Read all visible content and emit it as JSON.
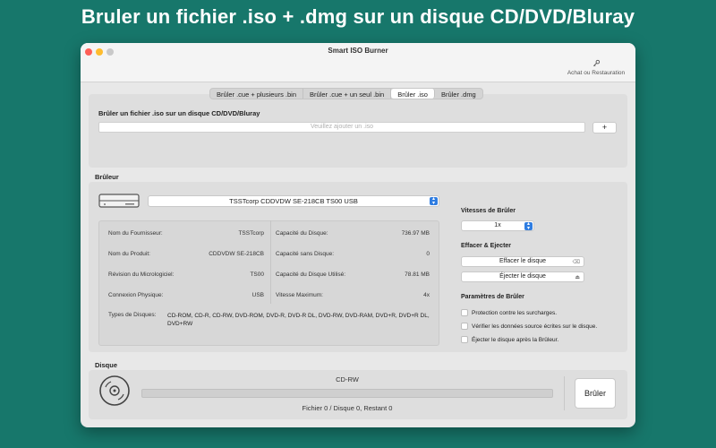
{
  "banner": {
    "title": "Bruler un fichier .iso + .dmg sur un disque CD/DVD/Bluray"
  },
  "window": {
    "title": "Smart ISO Burner",
    "toolbar_action_label": "Achat ou Restauration"
  },
  "tabs": [
    {
      "label": "Brûler .cue + plusieurs .bin",
      "active": false
    },
    {
      "label": "Brûler .cue + un seul .bin",
      "active": false
    },
    {
      "label": "Brûler .iso",
      "active": true
    },
    {
      "label": "Brûler .dmg",
      "active": false
    }
  ],
  "iso_section": {
    "title": "Brûler un fichier .iso sur un disque CD/DVD/Bluray",
    "placeholder": "Veuillez ajouter un .iso",
    "add_button": "+"
  },
  "burner": {
    "title": "Brûleur",
    "drive_selected": "TSSTcorp CDDVDW SE-218CB TS00 USB",
    "left_info": [
      {
        "label": "Nom du Fournisseur:",
        "value": "TSSTcorp"
      },
      {
        "label": "Nom du Produit:",
        "value": "CDDVDW SE-218CB"
      },
      {
        "label": "Révision du Micrologiciel:",
        "value": "TS00"
      },
      {
        "label": "Connexion Physique:",
        "value": "USB"
      }
    ],
    "right_info": [
      {
        "label": "Capacité du Disque:",
        "value": "736.97 MB"
      },
      {
        "label": "Capacité sans Disque:",
        "value": "0"
      },
      {
        "label": "Capacité du Disque Utilisé:",
        "value": "78.81 MB"
      },
      {
        "label": "Vitesse Maximum:",
        "value": "4x"
      }
    ],
    "disc_types_label": "Types de Disques:",
    "disc_types_value": "CD-ROM, CD-R, CD-RW, DVD-ROM, DVD-R, DVD-R DL, DVD-RW, DVD-RAM, DVD+R, DVD+R DL, DVD+RW",
    "speed_title": "Vitesses de Brûler",
    "speed_value": "1x",
    "erase_eject_title": "Effacer & Ejecter",
    "erase_button": "Effacer le disque",
    "eject_button": "Éjecter le disque",
    "params_title": "Paramètres de Brûler",
    "options": [
      {
        "label": "Protection contre les surcharges.",
        "checked": false
      },
      {
        "label": "Vérifier les données source écrites sur le disque.",
        "checked": false
      },
      {
        "label": "Éjecter le disque après la Brûleur.",
        "checked": false
      }
    ]
  },
  "disc": {
    "title": "Disque",
    "type": "CD-RW",
    "progress": 0,
    "status": "Fichier 0 / Disque 0, Restant 0",
    "burn_button": "Brûler"
  },
  "colors": {
    "background": "#17776b",
    "accent": "#2f7de1"
  }
}
